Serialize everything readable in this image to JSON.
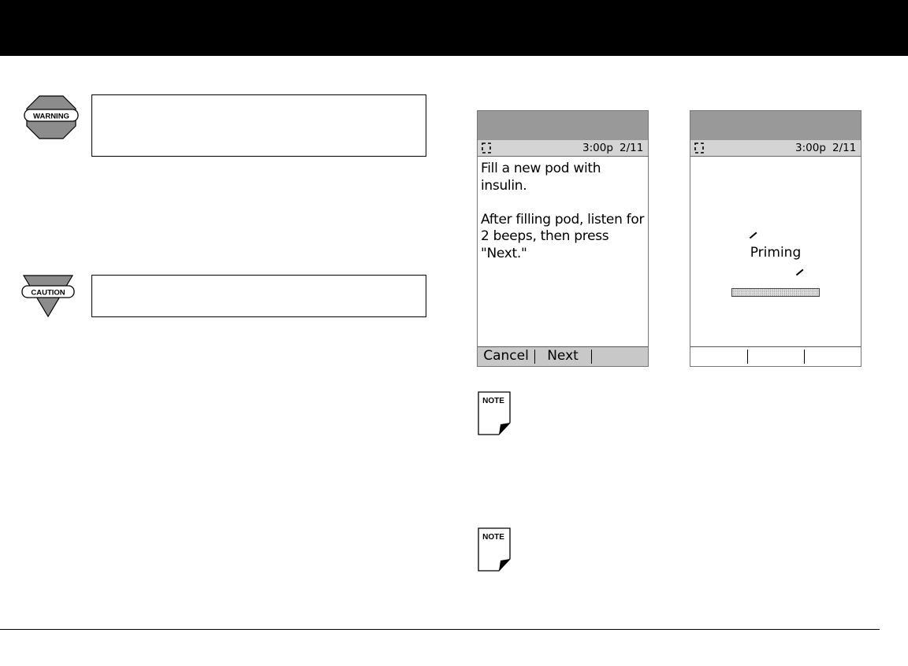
{
  "icons": {
    "warning": {
      "name": "warning-icon",
      "label": "WARNING"
    },
    "caution": {
      "name": "caution-icon",
      "label": "CAUTION"
    },
    "note": {
      "name": "note-icon",
      "label": "NOTE"
    }
  },
  "screens": [
    {
      "status": {
        "time": "3:00p",
        "date": "2/11"
      },
      "body": [
        "Fill a new pod with insulin.",
        "After filling pod, listen for 2 beeps, then press \"Next.\""
      ],
      "softkeys": [
        "Cancel",
        "Next",
        ""
      ]
    },
    {
      "status": {
        "time": "3:00p",
        "date": "2/11"
      },
      "label": "Priming",
      "progress": 1.0,
      "softkeys": [
        "",
        "",
        ""
      ]
    }
  ]
}
